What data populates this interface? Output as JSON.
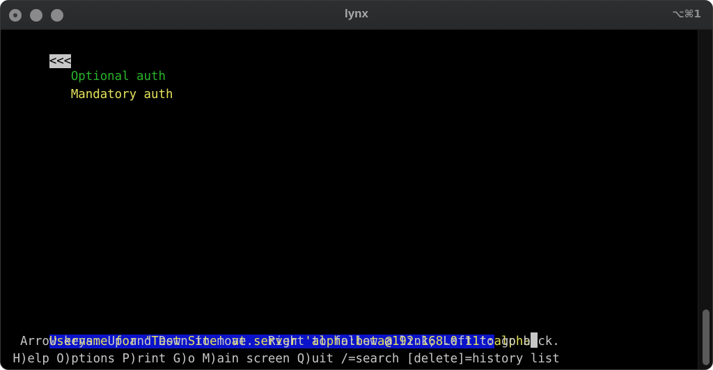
{
  "window": {
    "title": "lynx",
    "shortcut": "⌥⌘1"
  },
  "page": {
    "back_link": "<<<",
    "links": [
      {
        "label": "Optional auth",
        "color": "#29b32a"
      },
      {
        "label": "Mandatory auth",
        "color": "#e5e25c"
      }
    ]
  },
  "prompt": {
    "label": "Username for 'Test Site' at server 'alpha:beta@192.168.0.11':",
    "value": "alpha"
  },
  "help": {
    "line1": "  Arrow keys: Up and Down to move.  Right to follow a link; Left to go back.",
    "line2": " H)elp O)ptions P)rint G)o M)ain screen Q)uit /=search [delete]=history list"
  },
  "colors": {
    "prompt_background": "#0a13c9",
    "prompt_text": "#e5e25c",
    "help_text": "#c7c7c7"
  }
}
